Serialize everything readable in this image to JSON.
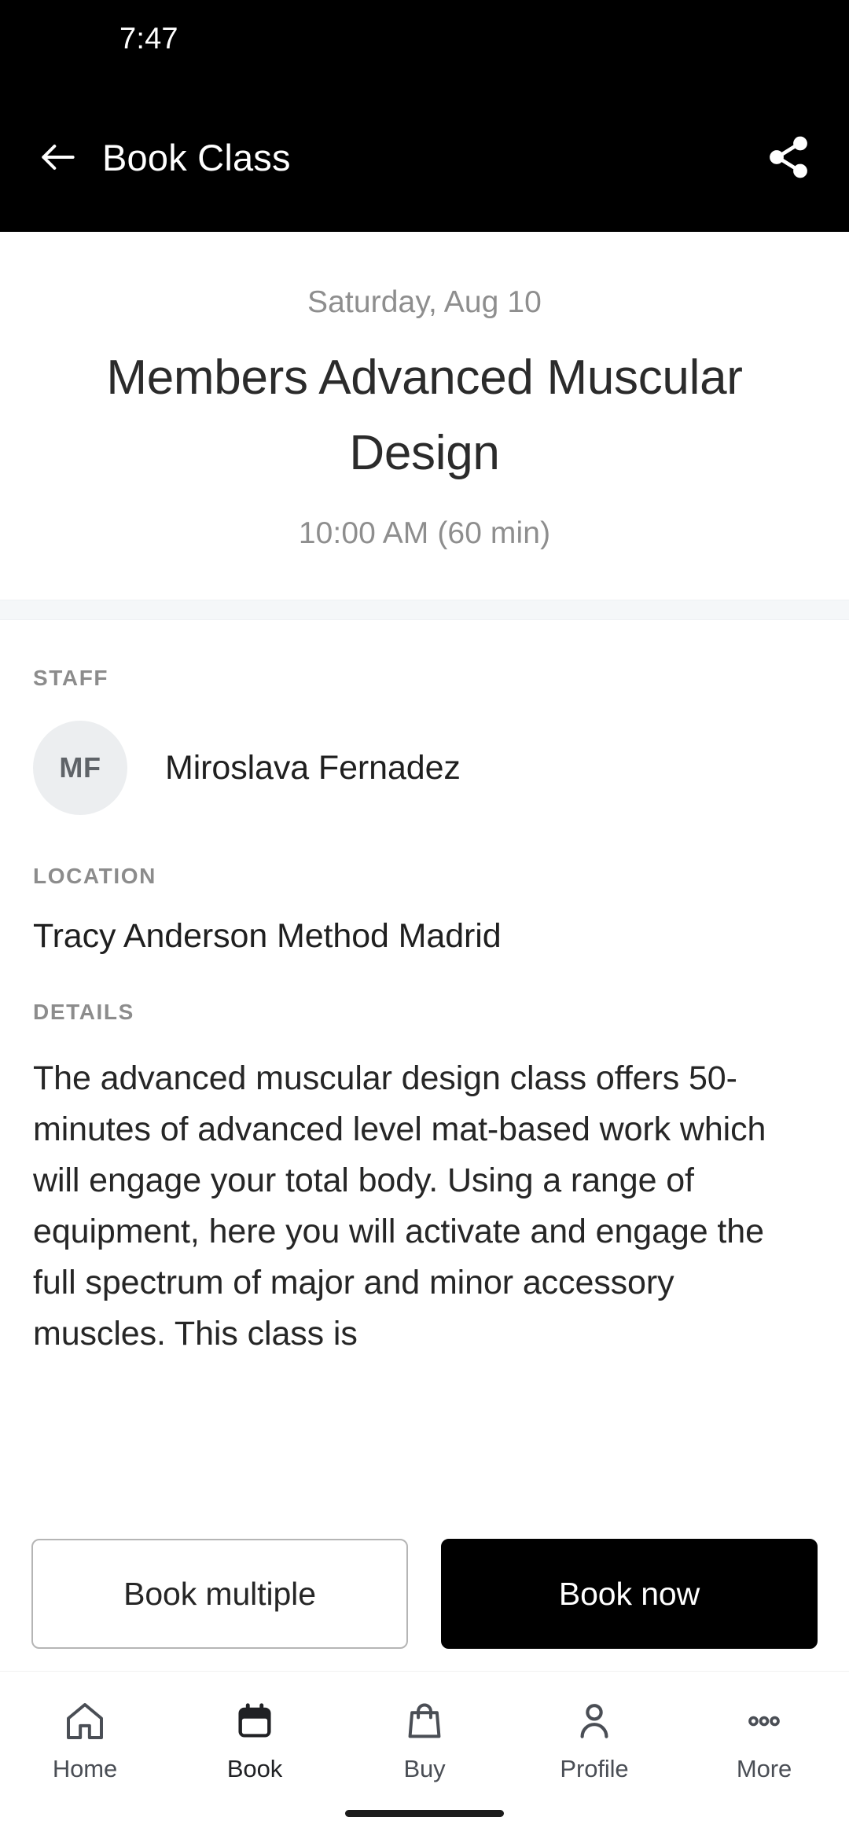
{
  "status_bar": {
    "time": "7:47"
  },
  "app_bar": {
    "title": "Book Class",
    "back_icon": "arrow-left-icon",
    "share_icon": "share-icon"
  },
  "class_header": {
    "date": "Saturday, Aug 10",
    "title": "Members Advanced Muscular Design",
    "time": "10:00 AM (60 min)"
  },
  "sections": {
    "staff": {
      "label": "STAFF",
      "avatar_initials": "MF",
      "name": "Miroslava Fernadez"
    },
    "location": {
      "label": "LOCATION",
      "value": "Tracy Anderson Method Madrid"
    },
    "details": {
      "label": "DETAILS",
      "text": "The advanced muscular design class offers 50-minutes of advanced level mat-based work which will engage your total body. Using a range of equipment, here you will activate and engage the full spectrum of major and minor accessory muscles. This class is"
    }
  },
  "actions": {
    "secondary_label": "Book multiple",
    "primary_label": "Book now"
  },
  "bottom_nav": {
    "items": [
      {
        "label": "Home",
        "icon": "home-icon",
        "active": false
      },
      {
        "label": "Book",
        "icon": "calendar-icon",
        "active": true
      },
      {
        "label": "Buy",
        "icon": "shopping-bag-icon",
        "active": false
      },
      {
        "label": "Profile",
        "icon": "person-icon",
        "active": false
      },
      {
        "label": "More",
        "icon": "more-dots-icon",
        "active": false
      }
    ]
  },
  "colors": {
    "appbar_background": "#000000",
    "primary_button": "#000000",
    "muted_text": "#8e8e8e",
    "avatar_background": "#eceef0",
    "divider": "#f5f7f9"
  }
}
